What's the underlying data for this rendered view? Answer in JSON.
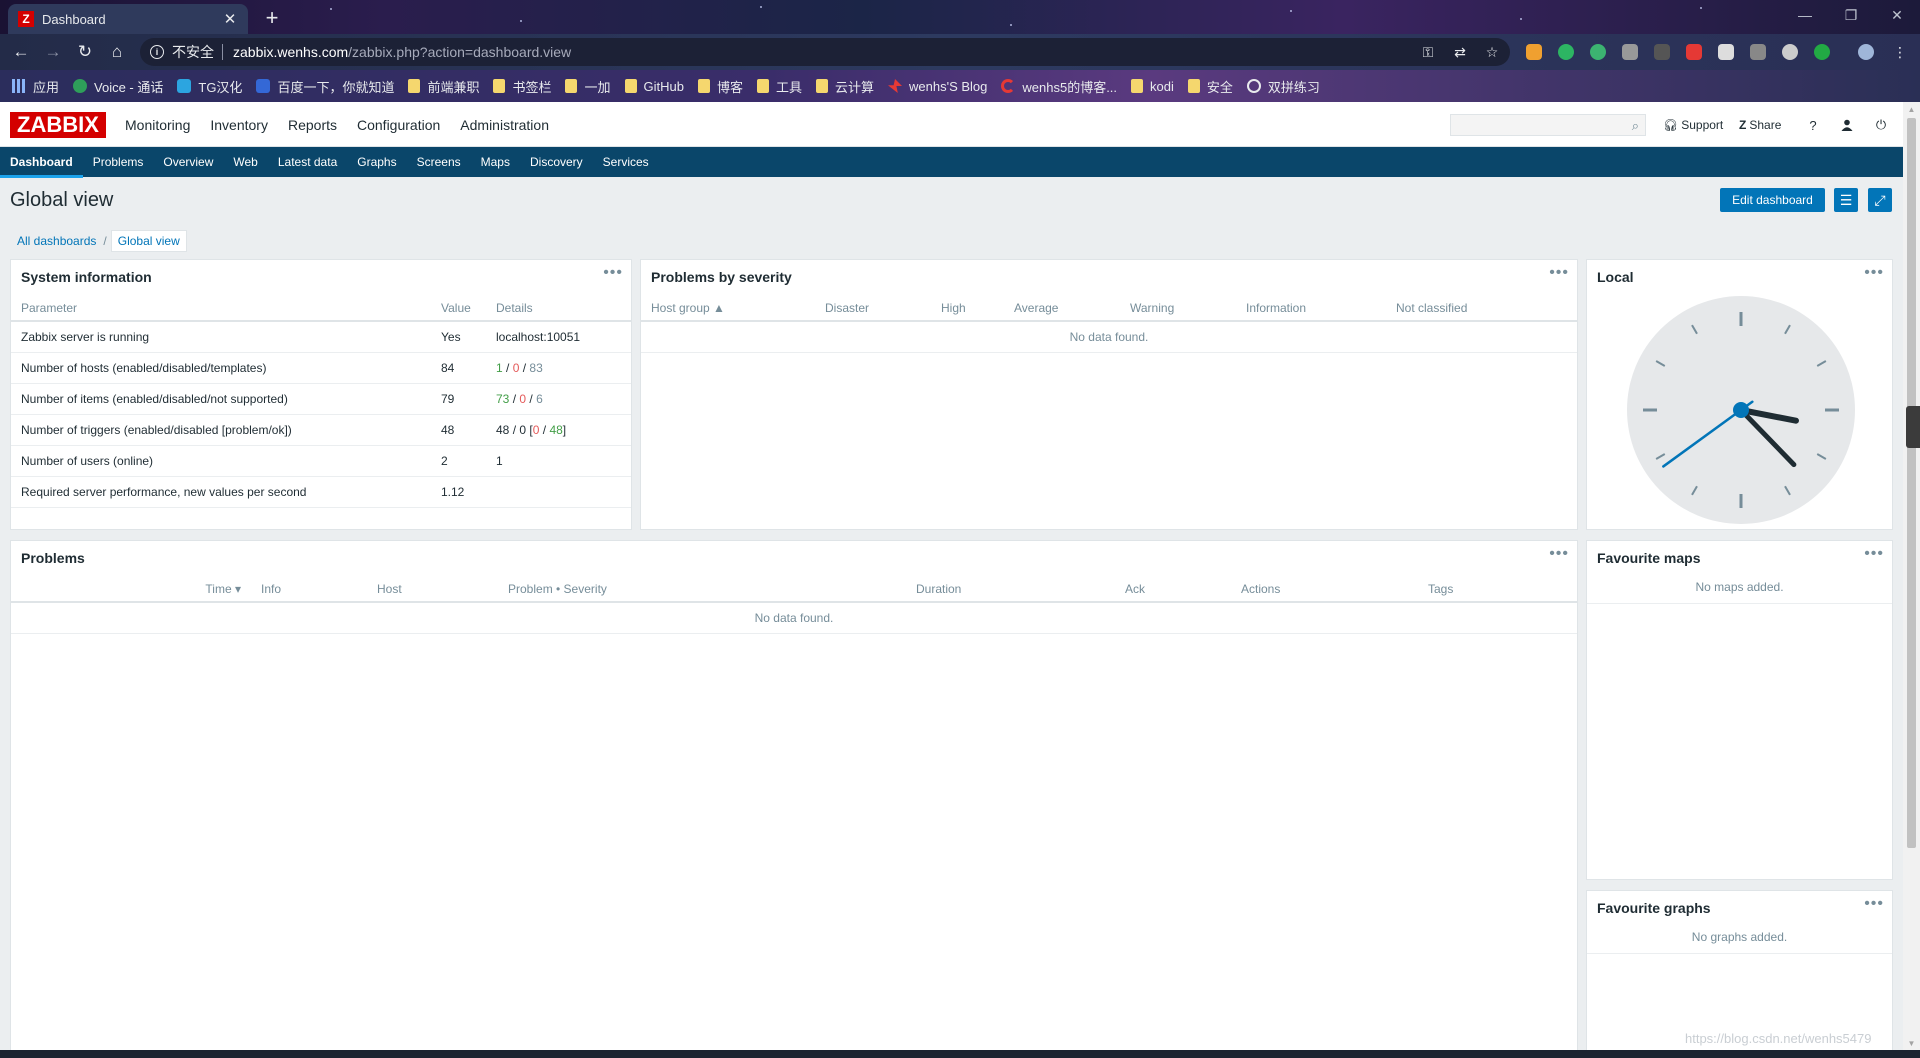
{
  "browser": {
    "tab_title": "Dashboard",
    "tab_favicon": "Z",
    "url_security": "不安全",
    "url_host": "zabbix.wenhs.com",
    "url_path": "/zabbix.php?action=dashboard.view",
    "bookmarks": [
      "应用",
      "Voice - 通话",
      "TG汉化",
      "百度一下，你就知道",
      "前端兼职",
      "书签栏",
      "一加",
      "GitHub",
      "博客",
      "工具",
      "云计算",
      "wenhs'S Blog",
      "wenhs5的博客...",
      "kodi",
      "安全",
      "双拼练习"
    ]
  },
  "zabbix": {
    "logo": "ZABBIX",
    "topmenu": [
      "Monitoring",
      "Inventory",
      "Reports",
      "Configuration",
      "Administration"
    ],
    "header_links": {
      "support": "Support",
      "share": "Share",
      "help": "?"
    },
    "submenu": [
      "Dashboard",
      "Problems",
      "Overview",
      "Web",
      "Latest data",
      "Graphs",
      "Screens",
      "Maps",
      "Discovery",
      "Services"
    ],
    "page_title": "Global view",
    "edit_dashboard": "Edit dashboard",
    "breadcrumb": {
      "all": "All dashboards",
      "sep": "/",
      "current": "Global view"
    }
  },
  "widgets": {
    "system_info": {
      "title": "System information",
      "headers": [
        "Parameter",
        "Value",
        "Details"
      ],
      "rows": [
        {
          "param": "Zabbix server is running",
          "value": "Yes",
          "details": "localhost:10051"
        },
        {
          "param": "Number of hosts (enabled/disabled/templates)",
          "value": "84",
          "d1": "1",
          "d2": "0",
          "d3": "83"
        },
        {
          "param": "Number of items (enabled/disabled/not supported)",
          "value": "79",
          "d1": "73",
          "d2": "0",
          "d3": "6"
        },
        {
          "param": "Number of triggers (enabled/disabled [problem/ok])",
          "value": "48",
          "d1": "48",
          "d2": "0",
          "d3": "0",
          "d4": "48"
        },
        {
          "param": "Number of users (online)",
          "value": "2",
          "d1": "1"
        },
        {
          "param": "Required server performance, new values per second",
          "value": "1.12"
        }
      ]
    },
    "problems_by_severity": {
      "title": "Problems by severity",
      "headers": [
        "Host group ▲",
        "Disaster",
        "High",
        "Average",
        "Warning",
        "Information",
        "Not classified"
      ],
      "empty": "No data found."
    },
    "local_clock": {
      "title": "Local",
      "time": {
        "hours": 3,
        "minutes": 22,
        "seconds": 39
      }
    },
    "problems": {
      "title": "Problems",
      "headers": [
        "Time ▾",
        "Info",
        "Host",
        "Problem • Severity",
        "Duration",
        "Ack",
        "Actions",
        "Tags"
      ],
      "empty": "No data found."
    },
    "favourite_maps": {
      "title": "Favourite maps",
      "empty": "No maps added."
    },
    "favourite_graphs": {
      "title": "Favourite graphs",
      "empty": "No graphs added."
    }
  },
  "watermark": "https://blog.csdn.net/wenhs5479"
}
